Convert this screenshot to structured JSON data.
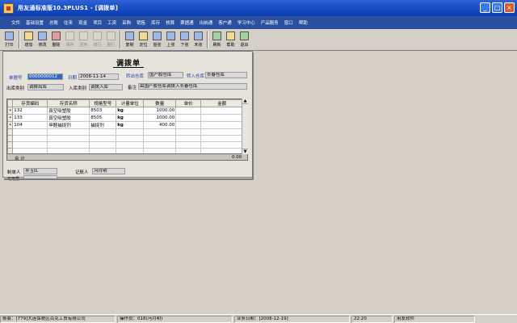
{
  "window": {
    "title": "用友通标准版10.3PLUS1 - [调拨单]"
  },
  "menu": [
    "文件",
    "基础设置",
    "总账",
    "往来",
    "现金",
    "项目",
    "工资",
    "采购",
    "销售",
    "库存",
    "核算",
    "票据通",
    "出纳通",
    "客户通",
    "学习中心",
    "产品服务",
    "窗口",
    "帮助"
  ],
  "toolbar": [
    {
      "label": "打印",
      "state": "on",
      "tint": "blue"
    },
    {
      "label": "增加",
      "state": "on",
      "tint": "yellow"
    },
    {
      "label": "修改",
      "state": "on",
      "tint": "blue"
    },
    {
      "label": "删除",
      "state": "on",
      "tint": "red"
    },
    {
      "label": "保存",
      "state": "off",
      "tint": ""
    },
    {
      "label": "放弃",
      "state": "off",
      "tint": ""
    },
    {
      "label": "增行",
      "state": "off",
      "tint": ""
    },
    {
      "label": "删行",
      "state": "off",
      "tint": ""
    },
    {
      "label": "复制",
      "state": "on",
      "tint": "blue"
    },
    {
      "label": "定位",
      "state": "on",
      "tint": "yellow"
    },
    {
      "label": "首张",
      "state": "on",
      "tint": "blue"
    },
    {
      "label": "上张",
      "state": "on",
      "tint": "blue"
    },
    {
      "label": "下张",
      "state": "on",
      "tint": "blue"
    },
    {
      "label": "末张",
      "state": "on",
      "tint": "blue"
    },
    {
      "label": "刷新",
      "state": "on",
      "tint": "green"
    },
    {
      "label": "帮助",
      "state": "on",
      "tint": "yellow"
    },
    {
      "label": "退出",
      "state": "on",
      "tint": "green"
    }
  ],
  "doc": {
    "title": "调拨单",
    "voucher_no_label": "单据号",
    "voucher_no": "0000000012",
    "date_label": "日期",
    "date": "2008-11-14",
    "out_wh_label": "转出仓库",
    "out_wh": "国产胶仓库",
    "in_wh_label": "转入仓库",
    "in_wh": "长春仓库",
    "out_type_label": "出库类别",
    "out_type": "调拨出库",
    "in_type_label": "入库类别",
    "in_type": "调拨入库",
    "remark_label": "备注",
    "remark": "由国产胶仓库调拨入长春仓库",
    "columns": [
      "存货编码",
      "存货名称",
      "规格型号",
      "计量单位",
      "数量",
      "单价",
      "金额"
    ],
    "rows": [
      {
        "code": "132",
        "name": "真空吸塑胶",
        "spec": "8503",
        "unit": "kg",
        "qty": "1000.00",
        "price": "",
        "amount": ""
      },
      {
        "code": "133",
        "name": "真空吸塑胶",
        "spec": "8505",
        "unit": "kg",
        "qty": "1000.00",
        "price": "",
        "amount": ""
      },
      {
        "code": "104",
        "name": "甲醛捕捉剂",
        "spec": "捕捉剂",
        "unit": "kg",
        "qty": "400.00",
        "price": "",
        "amount": ""
      }
    ],
    "total_label": "合  计",
    "total_amount": "0.00",
    "maker_label": "制单人",
    "maker": "孙玉红",
    "bookkeeper_label": "记账人",
    "bookkeeper": "冯月明",
    "available_label": "可用量"
  },
  "status": {
    "account": "账套：[779]大连保税区百克工贸有限公司",
    "operator": "操作员：018(冯月明)",
    "biz_date": "业务日期：[2008-12-19]",
    "time": "22:20",
    "vendor": "用友软件"
  }
}
